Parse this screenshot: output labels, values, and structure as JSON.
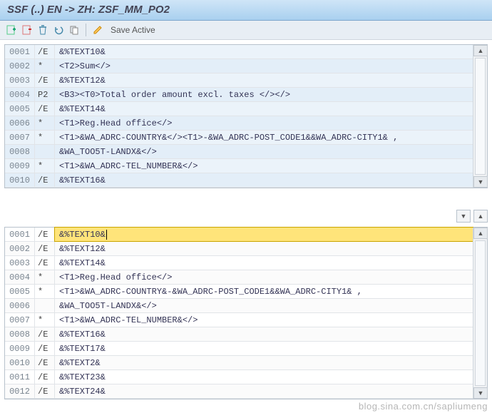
{
  "title": "SSF (..) EN -> ZH: ZSF_MM_PO2",
  "toolbar": {
    "add_icon": "add-icon",
    "subtract_icon": "subtract-icon",
    "delete_icon": "delete-icon",
    "undo_icon": "undo-icon",
    "copy_icon": "copy-icon",
    "edit_icon": "edit-icon",
    "save_label": "Save Active"
  },
  "pane_top": {
    "rows": [
      {
        "num": "0001",
        "tag": "/E",
        "txt": "&%TEXT10&"
      },
      {
        "num": "0002",
        "tag": "*",
        "txt": "<T2>Sum</>"
      },
      {
        "num": "0003",
        "tag": "/E",
        "txt": "&%TEXT12&"
      },
      {
        "num": "0004",
        "tag": "P2",
        "txt": "<B3><T0>Total order amount excl. taxes  </></>"
      },
      {
        "num": "0005",
        "tag": "/E",
        "txt": "&%TEXT14&"
      },
      {
        "num": "0006",
        "tag": "*",
        "txt": "<T1>Reg.Head office</>"
      },
      {
        "num": "0007",
        "tag": "*",
        "txt": "<T1>&WA_ADRC-COUNTRY&</><T1>-&WA_ADRC-POST_CODE1&&WA_ADRC-CITY1& ,"
      },
      {
        "num": "0008",
        "tag": "",
        "txt": "&WA_TOO5T-LANDX&</>"
      },
      {
        "num": "0009",
        "tag": "*",
        "txt": "<T1>&WA_ADRC-TEL_NUMBER&</>"
      },
      {
        "num": "0010",
        "tag": "/E",
        "txt": "&%TEXT16&"
      }
    ]
  },
  "pane_bottom": {
    "rows": [
      {
        "num": "0001",
        "tag": "/E",
        "txt": "&%TEXT10&",
        "active": true
      },
      {
        "num": "0002",
        "tag": "/E",
        "txt": "&%TEXT12&"
      },
      {
        "num": "0003",
        "tag": "/E",
        "txt": "&%TEXT14&"
      },
      {
        "num": "0004",
        "tag": "*",
        "txt": "<T1>Reg.Head office</>"
      },
      {
        "num": "0005",
        "tag": "*",
        "txt": "<T1>&WA_ADRC-COUNTRY&-&WA_ADRC-POST_CODE1&&WA_ADRC-CITY1& ,"
      },
      {
        "num": "0006",
        "tag": "",
        "txt": "&WA_TOO5T-LANDX&</>"
      },
      {
        "num": "0007",
        "tag": "*",
        "txt": "<T1>&WA_ADRC-TEL_NUMBER&</>"
      },
      {
        "num": "0008",
        "tag": "/E",
        "txt": "&%TEXT16&"
      },
      {
        "num": "0009",
        "tag": "/E",
        "txt": "&%TEXT17&"
      },
      {
        "num": "0010",
        "tag": "/E",
        "txt": "&%TEXT2&"
      },
      {
        "num": "0011",
        "tag": "/E",
        "txt": "&%TEXT23&"
      },
      {
        "num": "0012",
        "tag": "/E",
        "txt": "&%TEXT24&"
      }
    ]
  },
  "watermark": "blog.sina.com.cn/sapliumeng"
}
